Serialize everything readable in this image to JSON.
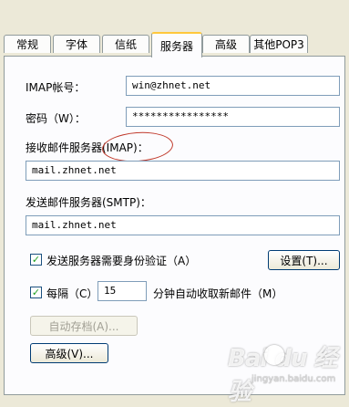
{
  "tabs": [
    {
      "label": "常规"
    },
    {
      "label": "字体"
    },
    {
      "label": "信纸"
    },
    {
      "label": "服务器",
      "active": true
    },
    {
      "label": "高级"
    },
    {
      "label": "其他POP3"
    }
  ],
  "server": {
    "imap_account_label": "IMAP帐号：",
    "imap_account_value": "win@zhnet.net",
    "password_label": "密码（W）：",
    "password_value": "****************",
    "incoming_label": "接收邮件服务器(IMAP)：",
    "incoming_value": "mail.zhnet.net",
    "outgoing_label": "发送邮件服务器(SMTP)：",
    "outgoing_value": "mail.zhnet.net",
    "auth_checkbox_label": "发送服务器需要身份验证（A）",
    "auth_checked": true,
    "settings_button": "设置(T)...",
    "every_checkbox_label": "每隔（C）",
    "every_checked": true,
    "interval_value": "15",
    "interval_suffix": "分钟自动收取新邮件（M）",
    "autoarchive_button": "自动存档(A)...",
    "advanced_button": "高级(V)..."
  },
  "watermark": {
    "logo": "Bai du 经验",
    "url": "jingyan.baidu.com"
  },
  "colors": {
    "annotation_oval": "#c0392b",
    "tab_highlight": "#ffc83c",
    "dialog_bg": "#ece9d8"
  }
}
